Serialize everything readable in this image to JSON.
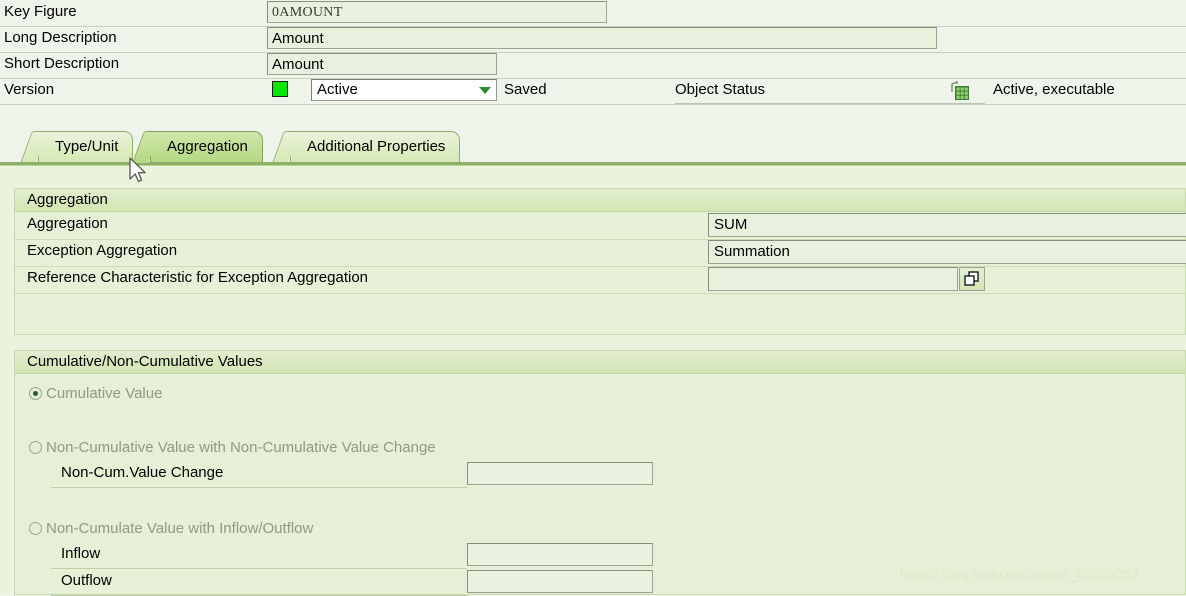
{
  "header": {
    "rows": [
      {
        "label": "Key Figure",
        "value": "0AMOUNT"
      },
      {
        "label": "Long Description",
        "value": "Amount"
      },
      {
        "label": "Short Description",
        "value": "Amount"
      }
    ],
    "version": {
      "label": "Version",
      "status_color": "#00e800",
      "selected": "Active",
      "saved_text": "Saved"
    },
    "object_status": {
      "label": "Object Status",
      "icon": "active-executable-grid-icon",
      "value": "Active, executable"
    }
  },
  "tabs": [
    {
      "label": "Type/Unit",
      "active": false
    },
    {
      "label": "Aggregation",
      "active": true
    },
    {
      "label": "Additional Properties",
      "active": false
    }
  ],
  "aggregation_panel": {
    "title": "Aggregation",
    "rows": [
      {
        "label": "Aggregation",
        "value": "SUM",
        "has_help": false
      },
      {
        "label": "Exception Aggregation",
        "value": "Summation",
        "has_help": false
      },
      {
        "label": "Reference Characteristic for Exception Aggregation",
        "value": "",
        "has_help": true
      }
    ]
  },
  "cumulative_panel": {
    "title": "Cumulative/Non-Cumulative Values",
    "radios": [
      {
        "label": "Cumulative Value",
        "checked": true
      },
      {
        "label": "Non-Cumulative Value with Non-Cumulative Value Change",
        "checked": false
      },
      {
        "label": "Non-Cumulate Value with Inflow/Outflow",
        "checked": false
      }
    ],
    "fields": [
      {
        "label": "Non-Cum.Value Change",
        "value": ""
      },
      {
        "label": "Inflow",
        "value": ""
      },
      {
        "label": "Outflow",
        "value": ""
      }
    ]
  },
  "watermark": "https://blog.csdn.net/weixin_45689053",
  "colors": {
    "page_background": "#eef4ea",
    "content_background": "#eaf3dd",
    "accent_green": "#8fae6c",
    "status_green": "#00e800"
  }
}
